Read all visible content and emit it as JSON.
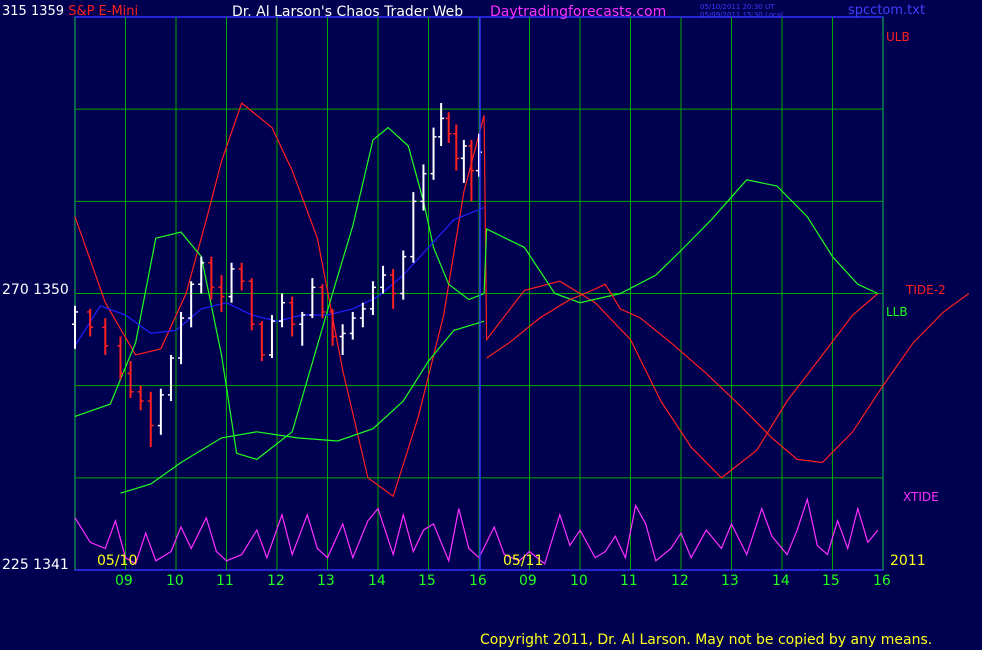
{
  "header": {
    "left_prefix": "315 ",
    "left_price": "1359",
    "symbol": "S&P E-Mini",
    "title": "Dr. Al Larson's Chaos Trader Web",
    "site": "Daytradingforecasts.com",
    "date_line1": "05/10/2011 20:30 UT",
    "date_line2": "05/09/2011 15:30 Local",
    "file": "spcctom.txt"
  },
  "y_axis_left": [
    {
      "label": "315  1359"
    },
    {
      "label": "270  1350"
    },
    {
      "label": "225  1341"
    }
  ],
  "right_labels": {
    "ulb": "ULB",
    "tide2": "TIDE-2",
    "llb": "LLB",
    "xtide": "XTIDE",
    "year": "2011"
  },
  "date_labels": [
    "05/10",
    "05/11"
  ],
  "hour_labels": [
    "09",
    "10",
    "11",
    "12",
    "13",
    "14",
    "15",
    "16",
    "09",
    "10",
    "11",
    "12",
    "13",
    "14",
    "15",
    "16"
  ],
  "copyright": "Copyright 2011, Dr. Al Larson. May not be copied by any means.",
  "colors": {
    "background": "#000050",
    "grid": "#00a800",
    "ulb": "#ff2020",
    "llb": "#20ff20",
    "xtide": "#ff30ff",
    "tide2": "#ff2020",
    "avg": "#2020ff",
    "price_up": "#ffffff",
    "price_down": "#ff2020",
    "now_line": "#3030ff"
  },
  "chart_data": {
    "type": "line",
    "title": "S&P E-Mini",
    "x_range_hours": [
      8,
      40
    ],
    "x_ticks": [
      9,
      10,
      11,
      12,
      13,
      14,
      15,
      16,
      33,
      34,
      35,
      36,
      37,
      38,
      39,
      40
    ],
    "ylim": [
      1341,
      1359
    ],
    "y_ticks": [
      1341,
      1350,
      1359
    ],
    "osc_ylim": [
      225,
      315
    ],
    "now_hour": 16.1,
    "series": [
      {
        "name": "ULB",
        "points": [
          [
            8,
            1352.5
          ],
          [
            8.6,
            1349.7
          ],
          [
            9.2,
            1348
          ],
          [
            9.7,
            1348.2
          ],
          [
            10.2,
            1350
          ],
          [
            10.6,
            1352.4
          ],
          [
            10.9,
            1354.3
          ],
          [
            11.3,
            1356.2
          ],
          [
            11.9,
            1355.4
          ],
          [
            12.3,
            1354
          ],
          [
            12.8,
            1351.8
          ],
          [
            13.3,
            1347.5
          ],
          [
            13.8,
            1344
          ],
          [
            14.3,
            1343.4
          ],
          [
            14.8,
            1346
          ],
          [
            15.3,
            1349.3
          ],
          [
            15.7,
            1353.3
          ],
          [
            16.1,
            1355.8
          ],
          [
            16.15,
            1348.5
          ],
          [
            16.9,
            1350.1
          ],
          [
            17.6,
            1350.4
          ],
          [
            18.3,
            1349.7
          ],
          [
            19.0,
            1348.5
          ],
          [
            19.6,
            1346.5
          ],
          [
            20.2,
            1345
          ],
          [
            20.8,
            1344
          ],
          [
            21.5,
            1344.9
          ],
          [
            22.1,
            1346.5
          ],
          [
            22.8,
            1348
          ],
          [
            23.4,
            1349.3
          ],
          [
            23.9,
            1350
          ]
        ]
      },
      {
        "name": "LLB",
        "points": [
          [
            8,
            1346
          ],
          [
            8.7,
            1346.4
          ],
          [
            9.2,
            1348.4
          ],
          [
            9.6,
            1351.8
          ],
          [
            10.1,
            1352
          ],
          [
            10.5,
            1351.2
          ],
          [
            10.9,
            1348
          ],
          [
            11.2,
            1344.8
          ],
          [
            11.6,
            1344.6
          ],
          [
            12.3,
            1345.5
          ],
          [
            13.1,
            1350
          ],
          [
            13.5,
            1352.2
          ],
          [
            13.9,
            1355
          ],
          [
            14.2,
            1355.4
          ],
          [
            14.6,
            1354.8
          ],
          [
            14.9,
            1353
          ],
          [
            15.1,
            1351.5
          ],
          [
            15.4,
            1350.3
          ],
          [
            15.8,
            1349.8
          ],
          [
            16.1,
            1350
          ],
          [
            16.15,
            1352.1
          ],
          [
            16.9,
            1351.5
          ],
          [
            17.5,
            1350
          ],
          [
            18.0,
            1349.7
          ],
          [
            18.8,
            1350
          ],
          [
            19.5,
            1350.6
          ],
          [
            20.0,
            1351.4
          ],
          [
            20.6,
            1352.4
          ],
          [
            21.3,
            1353.7
          ],
          [
            21.9,
            1353.5
          ],
          [
            22.5,
            1352.5
          ],
          [
            23.0,
            1351.2
          ],
          [
            23.5,
            1350.3
          ],
          [
            23.9,
            1350
          ]
        ]
      },
      {
        "name": "LLB-lower",
        "points": [
          [
            8.9,
            1343.5
          ],
          [
            9.5,
            1343.8
          ],
          [
            10.1,
            1344.5
          ],
          [
            10.9,
            1345.3
          ],
          [
            11.6,
            1345.5
          ],
          [
            12.4,
            1345.3
          ],
          [
            13.2,
            1345.2
          ],
          [
            13.9,
            1345.6
          ],
          [
            14.5,
            1346.5
          ],
          [
            15.0,
            1347.8
          ],
          [
            15.5,
            1348.8
          ],
          [
            16.1,
            1349.1
          ]
        ]
      },
      {
        "name": "TIDE-2",
        "points": [
          [
            16.15,
            1347.9
          ],
          [
            16.6,
            1348.4
          ],
          [
            17.2,
            1349.2
          ],
          [
            17.8,
            1349.8
          ],
          [
            18.1,
            1350
          ],
          [
            18.5,
            1350.3
          ],
          [
            18.8,
            1349.5
          ],
          [
            19.2,
            1349.2
          ],
          [
            19.8,
            1348.4
          ],
          [
            20.5,
            1347.4
          ],
          [
            21.2,
            1346.3
          ],
          [
            21.8,
            1345.3
          ],
          [
            22.3,
            1344.6
          ],
          [
            22.8,
            1344.5
          ],
          [
            23.4,
            1345.5
          ],
          [
            24.0,
            1347
          ],
          [
            24.6,
            1348.4
          ],
          [
            25.2,
            1349.4
          ],
          [
            25.7,
            1350
          ]
        ]
      },
      {
        "name": "Avg",
        "points": [
          [
            8,
            1348.3
          ],
          [
            8.5,
            1349.6
          ],
          [
            9.0,
            1349.3
          ],
          [
            9.5,
            1348.7
          ],
          [
            10.0,
            1348.8
          ],
          [
            10.5,
            1349.5
          ],
          [
            11.0,
            1349.7
          ],
          [
            11.5,
            1349.3
          ],
          [
            12.0,
            1349.1
          ],
          [
            12.5,
            1349.3
          ],
          [
            13.0,
            1349.3
          ],
          [
            13.5,
            1349.5
          ],
          [
            14.0,
            1349.9
          ],
          [
            14.5,
            1350.6
          ],
          [
            15.0,
            1351.5
          ],
          [
            15.5,
            1352.4
          ],
          [
            16.1,
            1352.8
          ]
        ]
      },
      {
        "name": "XTIDE",
        "points": [
          [
            8,
            1342.7
          ],
          [
            8.3,
            1341.9
          ],
          [
            8.6,
            1341.7
          ],
          [
            8.8,
            1342.6
          ],
          [
            9.0,
            1341.4
          ],
          [
            9.2,
            1341.2
          ],
          [
            9.4,
            1342.2
          ],
          [
            9.6,
            1341.3
          ],
          [
            9.9,
            1341.6
          ],
          [
            10.1,
            1342.4
          ],
          [
            10.3,
            1341.7
          ],
          [
            10.6,
            1342.7
          ],
          [
            10.8,
            1341.6
          ],
          [
            11.0,
            1341.3
          ],
          [
            11.3,
            1341.5
          ],
          [
            11.6,
            1342.3
          ],
          [
            11.8,
            1341.4
          ],
          [
            12.1,
            1342.8
          ],
          [
            12.3,
            1341.5
          ],
          [
            12.6,
            1342.8
          ],
          [
            12.8,
            1341.7
          ],
          [
            13.0,
            1341.4
          ],
          [
            13.3,
            1342.5
          ],
          [
            13.5,
            1341.4
          ],
          [
            13.8,
            1342.6
          ],
          [
            14.0,
            1343.0
          ],
          [
            14.3,
            1341.5
          ],
          [
            14.5,
            1342.8
          ],
          [
            14.7,
            1341.6
          ],
          [
            14.9,
            1342.3
          ],
          [
            15.1,
            1342.5
          ],
          [
            15.4,
            1341.3
          ],
          [
            15.6,
            1343.0
          ],
          [
            15.8,
            1341.7
          ],
          [
            16.0,
            1341.4
          ],
          [
            16.3,
            1342.4
          ],
          [
            16.5,
            1341.5
          ],
          [
            16.8,
            1341.3
          ],
          [
            17.0,
            1341.6
          ],
          [
            17.3,
            1341.2
          ],
          [
            17.6,
            1342.8
          ],
          [
            17.8,
            1341.8
          ],
          [
            18.0,
            1342.3
          ],
          [
            18.3,
            1341.4
          ],
          [
            18.5,
            1341.6
          ],
          [
            18.7,
            1342.1
          ],
          [
            18.9,
            1341.4
          ],
          [
            19.1,
            1343.1
          ],
          [
            19.3,
            1342.5
          ],
          [
            19.5,
            1341.3
          ],
          [
            19.8,
            1341.7
          ],
          [
            20.0,
            1342.2
          ],
          [
            20.2,
            1341.4
          ],
          [
            20.5,
            1342.3
          ],
          [
            20.8,
            1341.7
          ],
          [
            21.0,
            1342.5
          ],
          [
            21.3,
            1341.5
          ],
          [
            21.6,
            1343.0
          ],
          [
            21.8,
            1342.1
          ],
          [
            22.1,
            1341.5
          ],
          [
            22.3,
            1342.3
          ],
          [
            22.5,
            1343.3
          ],
          [
            22.7,
            1341.8
          ],
          [
            22.9,
            1341.5
          ],
          [
            23.1,
            1342.6
          ],
          [
            23.3,
            1341.7
          ],
          [
            23.5,
            1343.0
          ],
          [
            23.7,
            1341.9
          ],
          [
            23.9,
            1342.3
          ]
        ]
      }
    ],
    "price_bars": [
      [
        8.0,
        1349.0,
        1349.6,
        1348.2,
        1349.4
      ],
      [
        8.3,
        1349.4,
        1349.5,
        1348.6,
        1348.9
      ],
      [
        8.6,
        1348.9,
        1349.2,
        1348.0,
        1348.3
      ],
      [
        8.9,
        1348.3,
        1348.6,
        1347.2,
        1347.4
      ],
      [
        9.1,
        1347.4,
        1347.8,
        1346.6,
        1346.8
      ],
      [
        9.3,
        1346.8,
        1347.0,
        1346.2,
        1346.5
      ],
      [
        9.5,
        1346.5,
        1346.8,
        1345.0,
        1345.7
      ],
      [
        9.7,
        1345.7,
        1346.9,
        1345.4,
        1346.7
      ],
      [
        9.9,
        1346.7,
        1348.0,
        1346.5,
        1347.9
      ],
      [
        10.1,
        1347.9,
        1349.4,
        1347.7,
        1349.2
      ],
      [
        10.3,
        1349.2,
        1350.4,
        1348.9,
        1350.3
      ],
      [
        10.5,
        1350.3,
        1351.2,
        1350.0,
        1351.0
      ],
      [
        10.7,
        1351.0,
        1351.2,
        1349.8,
        1350.2
      ],
      [
        10.9,
        1350.2,
        1350.6,
        1349.4,
        1349.9
      ],
      [
        11.1,
        1349.9,
        1351.0,
        1349.7,
        1350.8
      ],
      [
        11.3,
        1350.8,
        1351.0,
        1350.1,
        1350.4
      ],
      [
        11.5,
        1350.4,
        1350.5,
        1348.8,
        1349.0
      ],
      [
        11.7,
        1349.0,
        1349.1,
        1347.8,
        1348.0
      ],
      [
        11.9,
        1348.0,
        1349.3,
        1347.9,
        1349.1
      ],
      [
        12.1,
        1349.1,
        1350.0,
        1348.9,
        1349.7
      ],
      [
        12.3,
        1349.7,
        1349.9,
        1348.6,
        1349.0
      ],
      [
        12.5,
        1349.0,
        1349.4,
        1348.3,
        1349.3
      ],
      [
        12.7,
        1349.3,
        1350.5,
        1349.2,
        1350.2
      ],
      [
        12.9,
        1350.2,
        1350.3,
        1349.2,
        1349.4
      ],
      [
        13.1,
        1349.4,
        1349.5,
        1348.3,
        1348.6
      ],
      [
        13.3,
        1348.6,
        1349.0,
        1348.0,
        1348.7
      ],
      [
        13.5,
        1348.7,
        1349.4,
        1348.5,
        1349.2
      ],
      [
        13.7,
        1349.2,
        1349.7,
        1348.9,
        1349.5
      ],
      [
        13.9,
        1349.5,
        1350.4,
        1349.3,
        1350.2
      ],
      [
        14.1,
        1350.2,
        1350.9,
        1350.0,
        1350.6
      ],
      [
        14.3,
        1350.6,
        1350.8,
        1349.5,
        1350.0
      ],
      [
        14.5,
        1350.0,
        1351.4,
        1349.8,
        1351.2
      ],
      [
        14.7,
        1351.2,
        1353.3,
        1351.0,
        1353.0
      ],
      [
        14.9,
        1353.0,
        1354.2,
        1352.7,
        1353.9
      ],
      [
        15.1,
        1353.9,
        1355.4,
        1353.7,
        1355.1
      ],
      [
        15.25,
        1355.1,
        1356.2,
        1354.8,
        1355.7
      ],
      [
        15.4,
        1355.7,
        1355.9,
        1354.9,
        1355.2
      ],
      [
        15.55,
        1355.2,
        1355.5,
        1354.0,
        1354.4
      ],
      [
        15.7,
        1354.4,
        1355.0,
        1353.6,
        1354.8
      ],
      [
        15.85,
        1354.8,
        1355.0,
        1353.0,
        1354.0
      ],
      [
        16.0,
        1354.0,
        1355.2,
        1353.8,
        1354.6
      ]
    ]
  }
}
